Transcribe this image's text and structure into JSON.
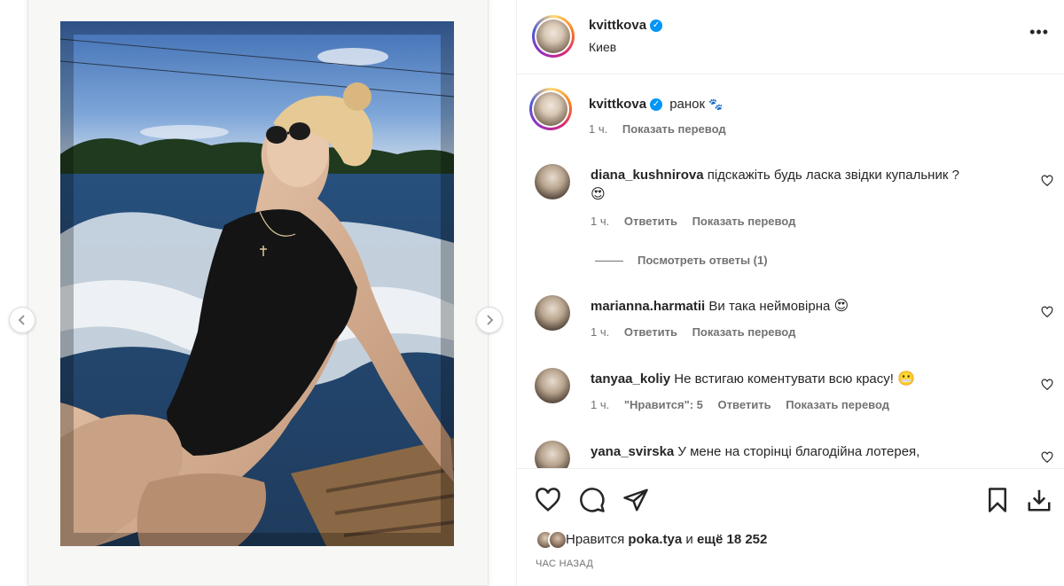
{
  "post": {
    "author": "kvittkova",
    "location": "Киев",
    "caption": "ранок",
    "caption_emoji": "🐾",
    "caption_time": "1 ч.",
    "show_translation": "Показать перевод"
  },
  "comments": [
    {
      "username": "diana_kushnirova",
      "text": "підскажіть будь ласка звідки купальник ?",
      "emoji": "😍",
      "time": "1 ч.",
      "reply": "Ответить",
      "translate": "Показать перевод",
      "view_replies": "Посмотреть ответы (1)"
    },
    {
      "username": "marianna.harmatii",
      "text": "Ви така неймовірна",
      "emoji": "😍",
      "time": "1 ч.",
      "reply": "Ответить",
      "translate": "Показать перевод"
    },
    {
      "username": "tanyaa_koliy",
      "text": "Не встигаю коментувати всю красу!",
      "emoji": "😬",
      "time": "1 ч.",
      "likes": "\"Нравится\": 5",
      "reply": "Ответить",
      "translate": "Показать перевод"
    },
    {
      "username": "yana_svirska",
      "text": "У мене на сторінці благодійна лотерея,"
    }
  ],
  "likes": {
    "prefix": "Нравится",
    "user": "poka.tya",
    "joiner": "и",
    "others": "ещё 18 252"
  },
  "timestamp": "ЧАС НАЗАД",
  "icons": [
    "like-heart-icon",
    "comment-icon",
    "share-icon",
    "bookmark-icon",
    "download-icon",
    "more-icon",
    "chevron-left-icon",
    "chevron-right-icon",
    "verified-badge-icon"
  ],
  "colors": {
    "verified": "#0095f6",
    "muted": "#737373",
    "text": "#262626"
  }
}
